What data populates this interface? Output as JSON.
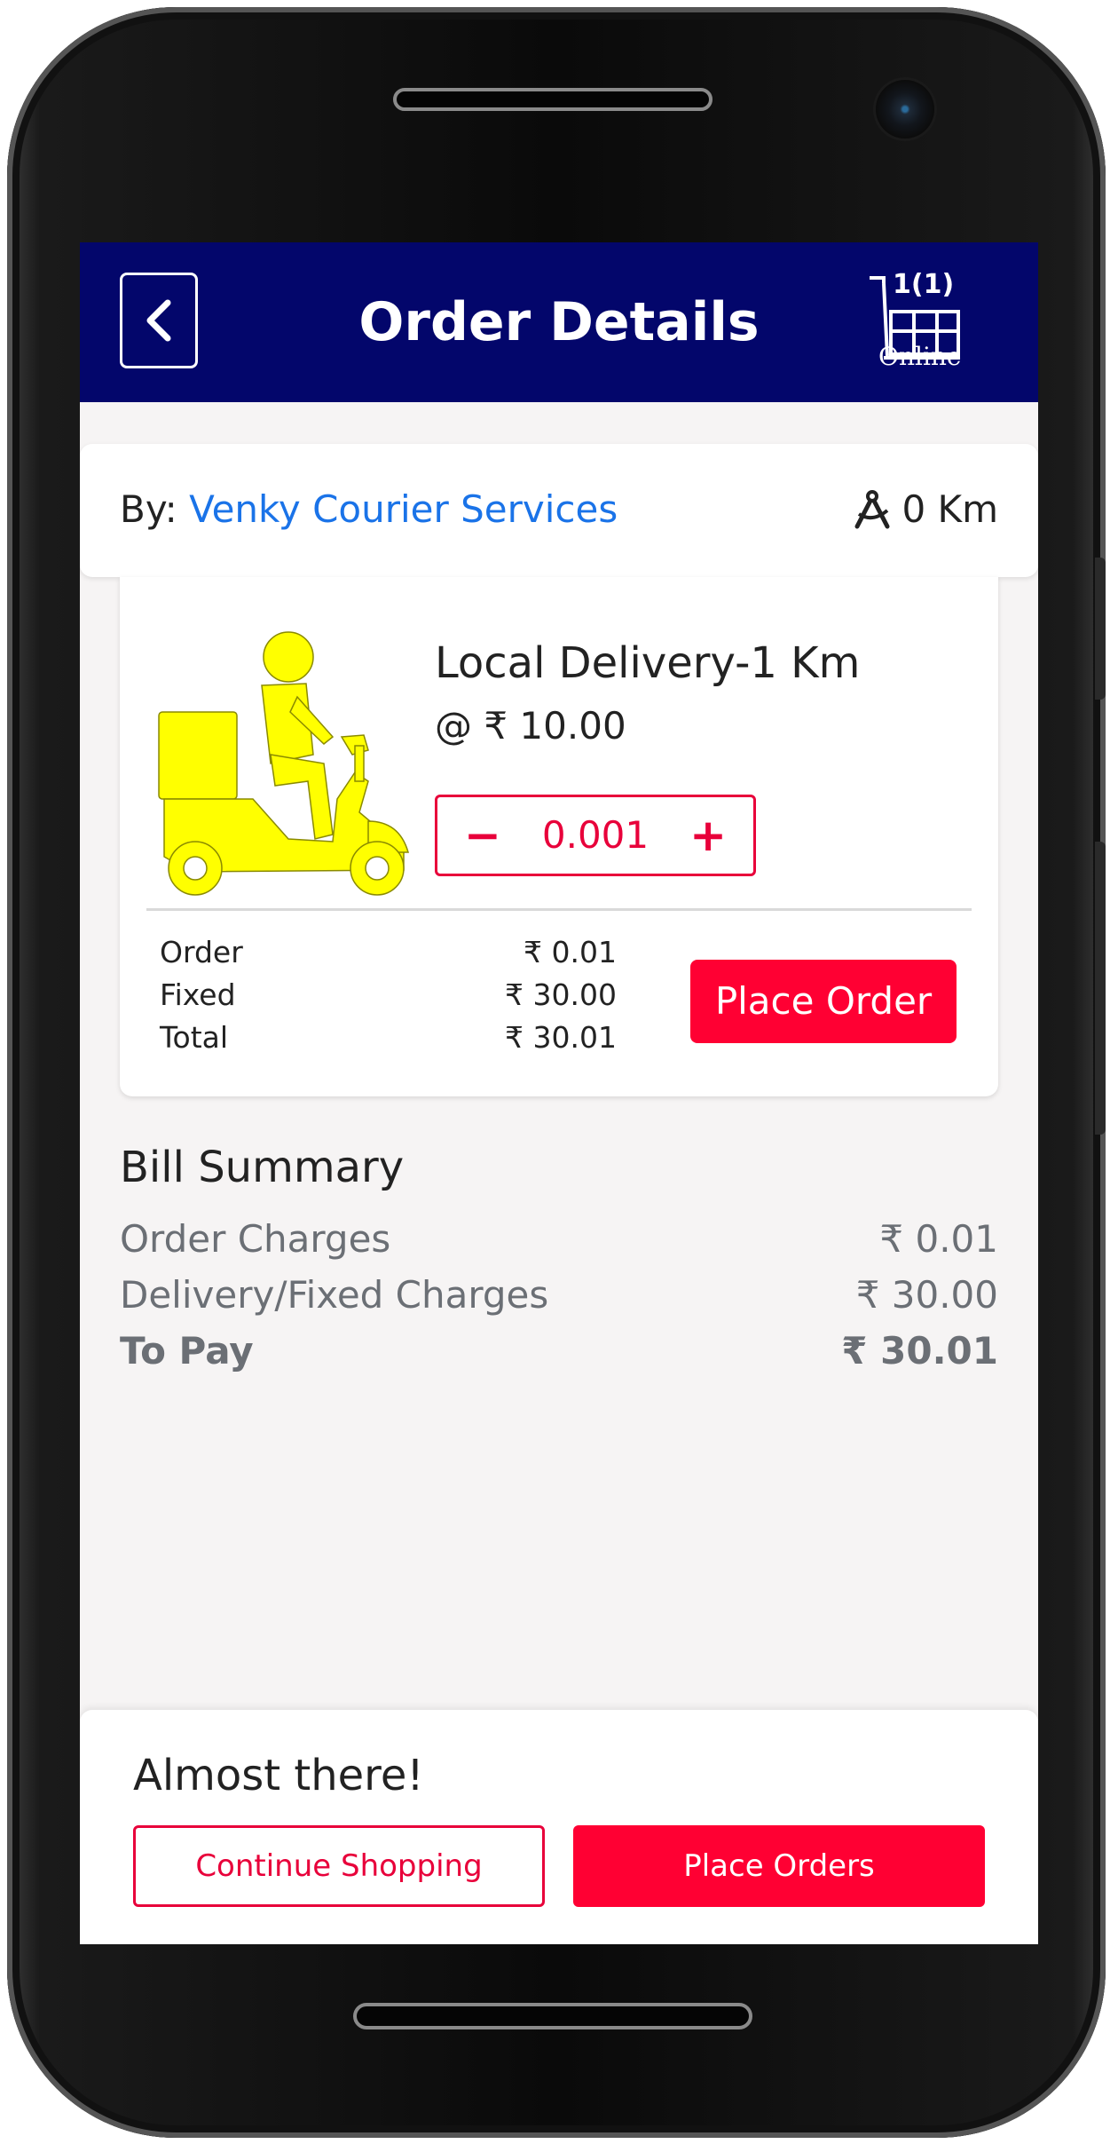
{
  "header": {
    "title": "Order Details",
    "cart_count": "1(1)",
    "cart_status": "Online"
  },
  "vendor": {
    "by_label": "By:",
    "name": "Venky Courier Services",
    "distance": "0 Km"
  },
  "product": {
    "name": "Local Delivery-1 Km",
    "price": "@ ₹ 10.00",
    "quantity": "0.001",
    "minus_symbol": "−",
    "plus_symbol": "+",
    "summary": [
      {
        "label": "Order",
        "value": "₹ 0.01"
      },
      {
        "label": "Fixed",
        "value": "₹ 30.00"
      },
      {
        "label": "Total",
        "value": "₹ 30.01"
      }
    ],
    "place_order_label": "Place Order",
    "image_color": "#ffff00"
  },
  "bill": {
    "title": "Bill Summary",
    "rows": [
      {
        "label": "Order Charges",
        "value": "₹ 0.01"
      },
      {
        "label": "Delivery/Fixed Charges",
        "value": "₹ 30.00"
      },
      {
        "label": "To Pay",
        "value": "₹ 30.01"
      }
    ]
  },
  "footer": {
    "heading": "Almost there!",
    "continue_label": "Continue Shopping",
    "place_orders_label": "Place Orders"
  },
  "colors": {
    "header_bg": "#03066b",
    "accent": "#ff0033",
    "link": "#1a73e8"
  },
  "icons": {
    "back": "chevron-left-icon",
    "cart": "cart-icon",
    "distance": "compass-icon",
    "product": "delivery-scooter-icon"
  }
}
